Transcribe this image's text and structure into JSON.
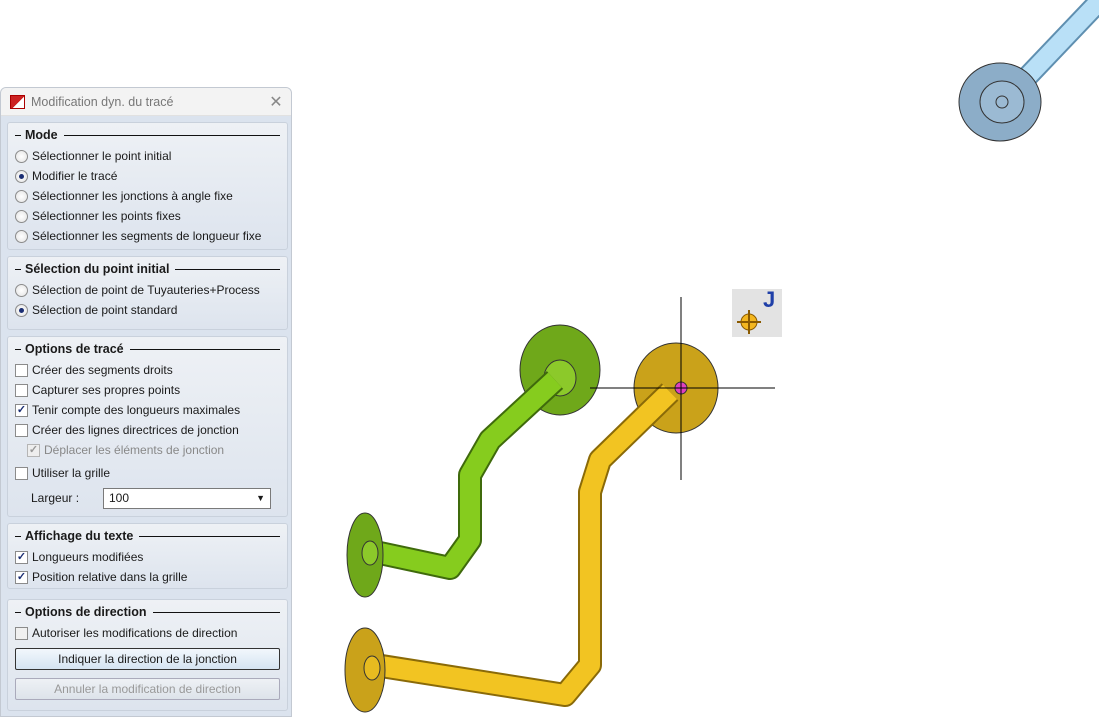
{
  "dialog": {
    "title": "Modification dyn. du tracé",
    "close_icon": "close-icon"
  },
  "mode": {
    "title": "Mode",
    "options": [
      "Sélectionner le point initial",
      "Modifier le tracé",
      "Sélectionner les jonctions à angle fixe",
      "Sélectionner les points fixes",
      "Sélectionner les segments de longueur fixe"
    ],
    "selected": 1
  },
  "initial": {
    "title": "Sélection du point initial",
    "options": [
      "Sélection de point de Tuyauteries+Process",
      "Sélection de point standard"
    ],
    "selected": 1
  },
  "trace": {
    "title": "Options de tracé",
    "items": [
      {
        "label": "Créer des segments droits",
        "checked": false
      },
      {
        "label": "Capturer ses propres points",
        "checked": false
      },
      {
        "label": "Tenir compte des longueurs maximales",
        "checked": true
      },
      {
        "label": "Créer des lignes directrices de jonction",
        "checked": false
      },
      {
        "label": "Déplacer les éléments de jonction",
        "checked": true,
        "disabled": true
      },
      {
        "label": "Utiliser la grille",
        "checked": false
      }
    ],
    "width_label": "Largeur :",
    "width_value": "100"
  },
  "text_display": {
    "title": "Affichage du texte",
    "items": [
      {
        "label": "Longueurs modifiées",
        "checked": true
      },
      {
        "label": "Position relative dans la grille",
        "checked": true
      }
    ]
  },
  "direction": {
    "title": "Options de direction",
    "allow_label": "Autoriser les modifications de direction",
    "allow_checked": false,
    "indicate_button": "Indiquer la direction de la jonction",
    "cancel_button": "Annuler la modification de direction"
  },
  "cursor_hint": {
    "letter": "J"
  },
  "colors": {
    "green": "#7fc31c",
    "yellow": "#f0c020",
    "blue": "#a8d4f0"
  }
}
